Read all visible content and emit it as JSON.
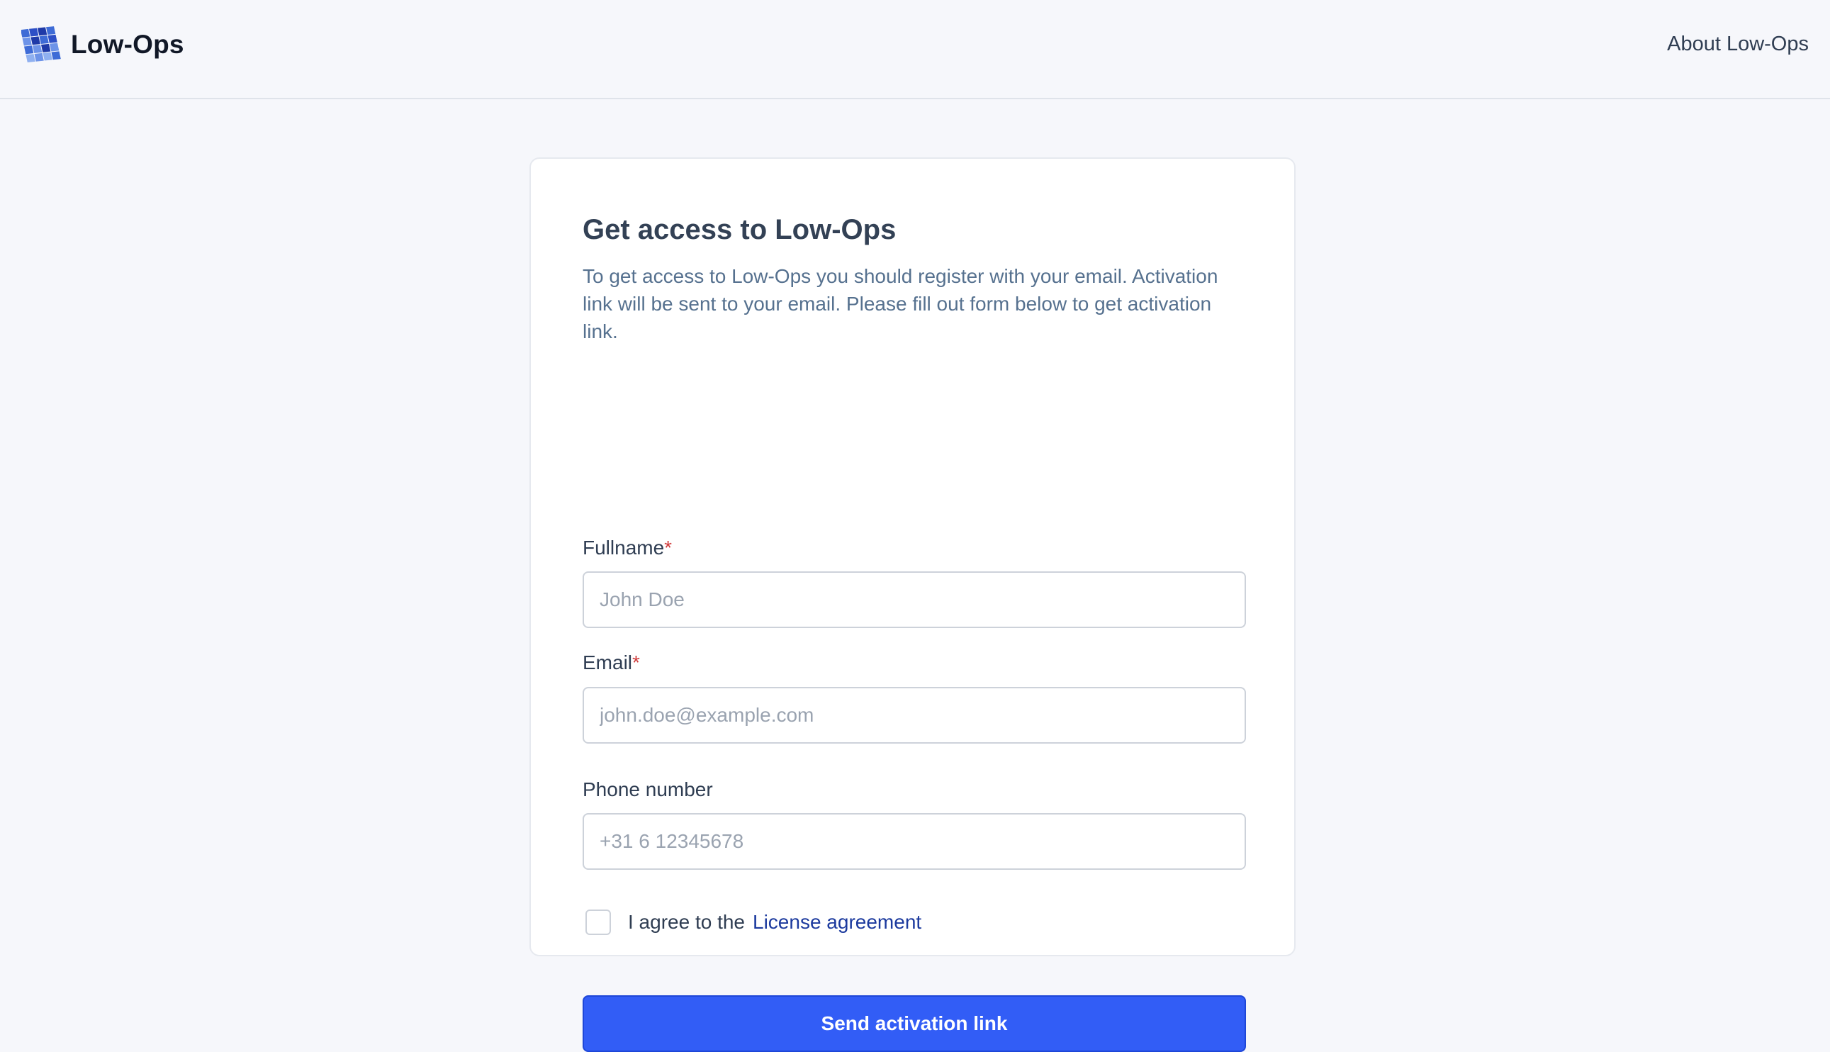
{
  "header": {
    "brand_name": "Low-Ops",
    "logo_icon": "grid-cube-logo-icon",
    "about_link": "About Low-Ops"
  },
  "form": {
    "title": "Get access to Low-Ops",
    "description": "To get access to Low-Ops you should register with your email. Activation link will be sent to your email. Please fill out form below to get activation link.",
    "fullname": {
      "label": "Fullname",
      "required_marker": "*",
      "value": "",
      "placeholder": "John Doe"
    },
    "email": {
      "label": "Email",
      "required_marker": "*",
      "value": "",
      "placeholder": "john.doe@example.com"
    },
    "phone": {
      "label": "Phone number",
      "value": "",
      "placeholder": "+31 6 12345678"
    },
    "agreement": {
      "checked": false,
      "text": "I agree to the",
      "link_text": "License agreement"
    },
    "submit_label": "Send activation link"
  },
  "colors": {
    "page_background": "#f6f7fb",
    "card_background": "#ffffff",
    "primary_button": "#325df6",
    "link": "#1c3a9e",
    "required_marker": "#d03c3c",
    "logo_blue": "#2d4fd0"
  }
}
